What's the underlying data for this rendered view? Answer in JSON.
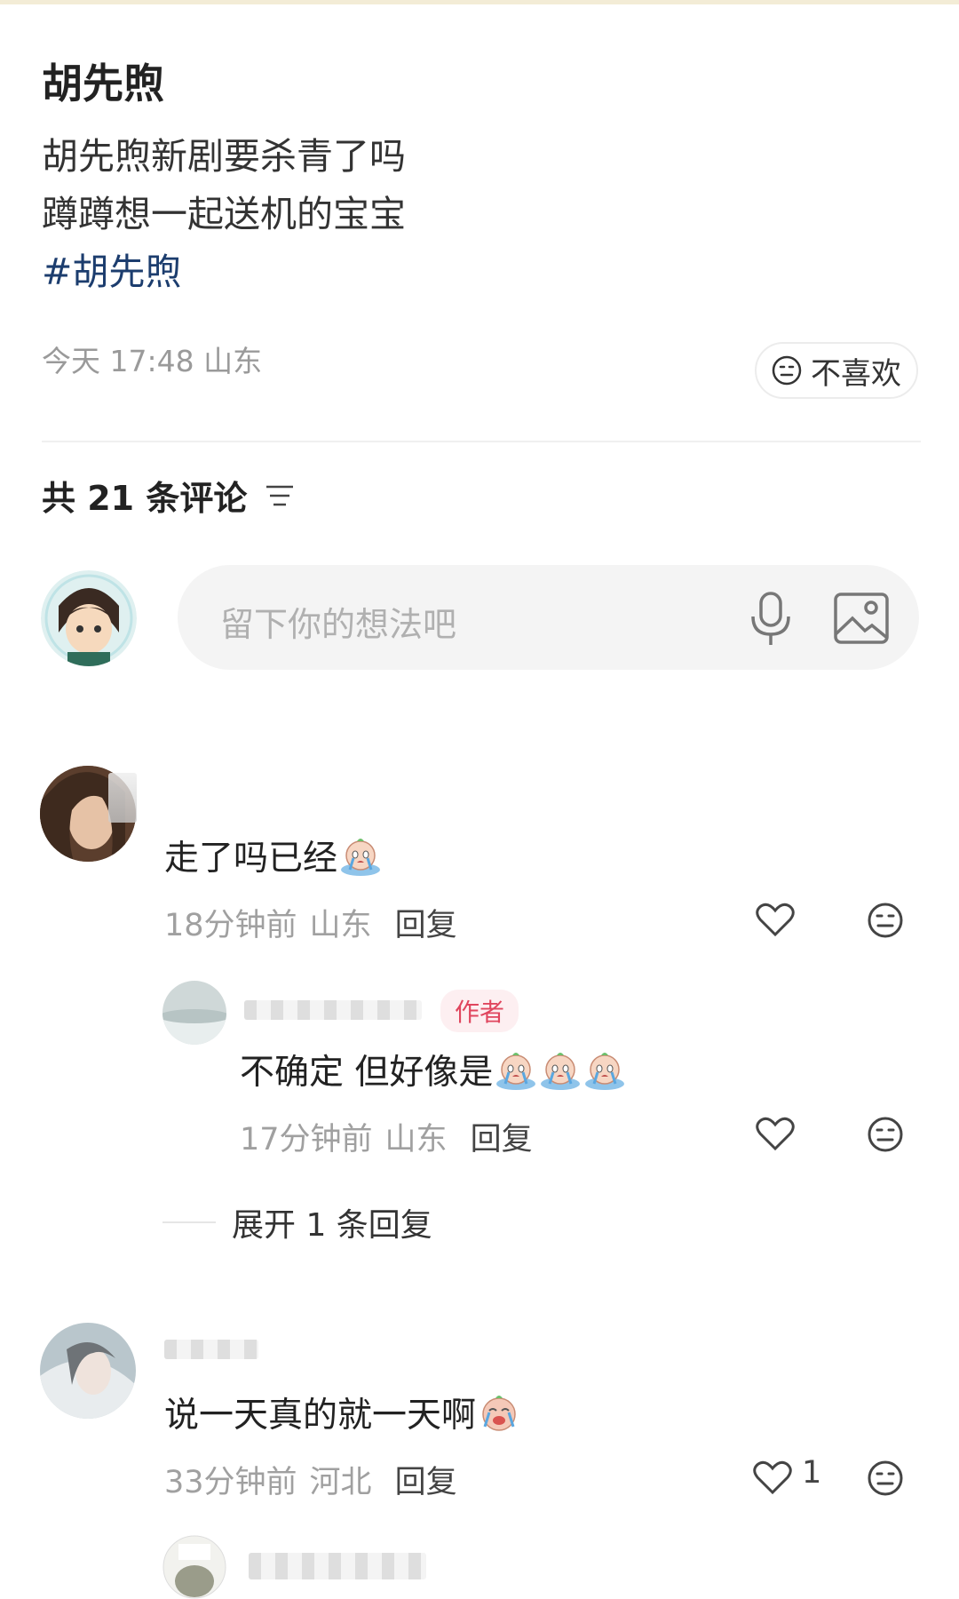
{
  "post": {
    "title": "胡先煦",
    "line1": "胡先煦新剧要杀青了吗",
    "line2": "蹲蹲想一起送机的宝宝",
    "hashtag": "#胡先煦",
    "meta": "今天 17:48 山东",
    "dislike_label": "不喜欢"
  },
  "comments_header": {
    "count_label": "共 21 条评论"
  },
  "comment_input": {
    "placeholder": "留下你的想法吧"
  },
  "comments": [
    {
      "text": "走了吗已经",
      "time": "18分钟前",
      "location": "山东",
      "reply_label": "回复"
    },
    {
      "badge": "作者",
      "text": "不确定 但好像是",
      "time": "17分钟前",
      "location": "山东",
      "reply_label": "回复"
    },
    {
      "text": "说一天真的就一天啊",
      "time": "33分钟前",
      "location": "河北",
      "reply_label": "回复",
      "likes": "1"
    }
  ],
  "expand_replies": "展开 1 条回复",
  "colors": {
    "hashtag": "#1c3d6e",
    "author_badge_text": "#e0465e",
    "author_badge_bg": "#fdeff1",
    "input_bg": "#f4f4f4"
  }
}
